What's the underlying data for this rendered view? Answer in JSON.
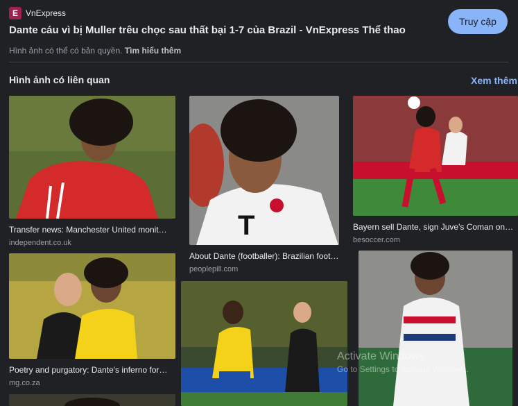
{
  "source": {
    "icon": "vnexpress-logo-icon",
    "icon_letter": "E",
    "name": "VnExpress"
  },
  "visit_button": "Truy cập",
  "title": "Dante cáu vì bị Muller trêu chọc sau thất bại 1-7 của Brazil - VnExpress Thể thao",
  "copyright": {
    "text": "Hình ảnh có thể có bản quyền.",
    "link": "Tìm hiểu thêm"
  },
  "related": {
    "heading": "Hình ảnh có liên quan",
    "see_more": "Xem thêm",
    "items": [
      {
        "caption": "Transfer news: Manchester United monit…",
        "domain": "independent.co.uk"
      },
      {
        "caption": "About Dante (footballer): Brazilian footb…",
        "domain": "peoplepill.com"
      },
      {
        "caption": "Bayern sell Dante, sign Juve's Coman on…",
        "domain": "besoccer.com"
      },
      {
        "caption": "Poetry and purgatory: Dante's inferno for…",
        "domain": "mg.co.za"
      },
      {
        "caption": "",
        "domain": ""
      },
      {
        "caption": "",
        "domain": ""
      }
    ]
  },
  "watermark": {
    "line1": "Activate Windows",
    "line2": "Go to Settings to activate Windows."
  }
}
